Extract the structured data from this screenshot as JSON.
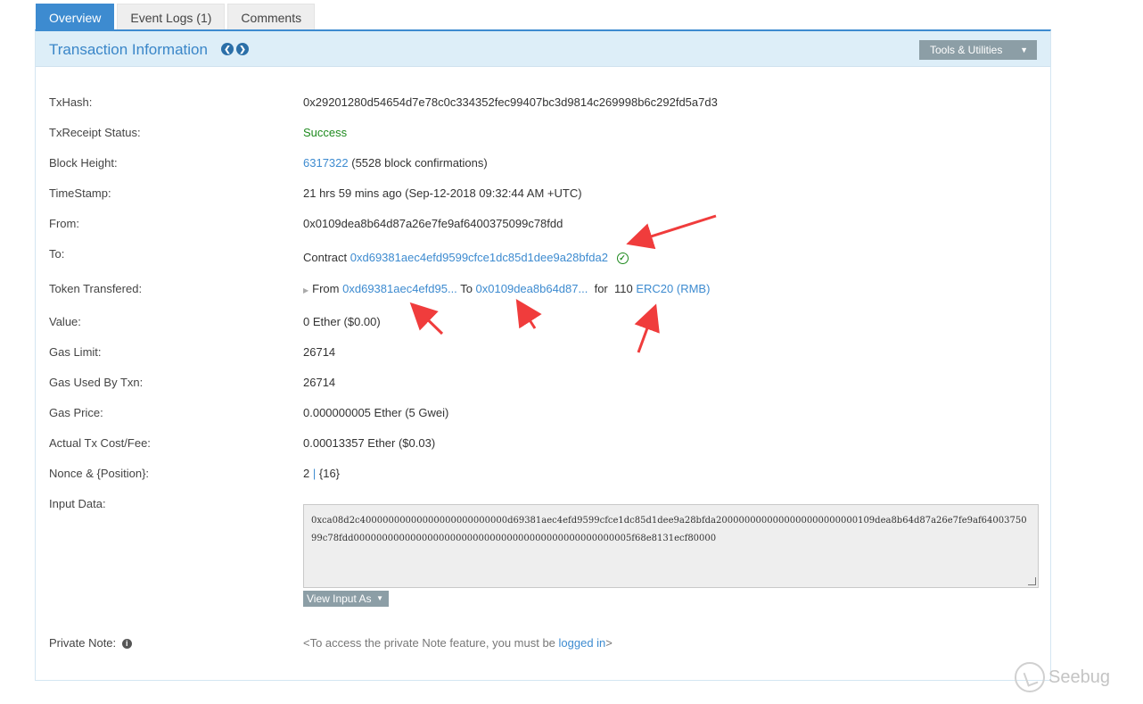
{
  "tabs": [
    {
      "label": "Overview",
      "active": true
    },
    {
      "label": "Event Logs (1)",
      "active": false
    },
    {
      "label": "Comments",
      "active": false
    }
  ],
  "header": {
    "title": "Transaction Information",
    "tools_label": "Tools & Utilities"
  },
  "rows": {
    "txhash": {
      "label": "TxHash:",
      "value": "0x29201280d54654d7e78c0c334352fec99407bc3d9814c269998b6c292fd5a7d3"
    },
    "status": {
      "label": "TxReceipt Status:",
      "value": "Success"
    },
    "block": {
      "label": "Block Height:",
      "block": "6317322",
      "confirmations": "(5528 block confirmations)"
    },
    "timestamp": {
      "label": "TimeStamp:",
      "value": "21 hrs 59 mins ago (Sep-12-2018 09:32:44 AM +UTC)"
    },
    "from": {
      "label": "From:",
      "value": "0x0109dea8b64d87a26e7fe9af6400375099c78fdd"
    },
    "to": {
      "label": "To:",
      "prefix": "Contract",
      "address": "0xd69381aec4efd9599cfce1dc85d1dee9a28bfda2"
    },
    "token": {
      "label": "Token Transfered:",
      "from_word": "From",
      "from_addr": "0xd69381aec4efd95...",
      "to_word": "To",
      "to_addr": "0x0109dea8b64d87...",
      "for_word": "for",
      "amount": "110",
      "token_name": "ERC20 (RMB)"
    },
    "value": {
      "label": "Value:",
      "value": "0 Ether ($0.00)"
    },
    "gas_limit": {
      "label": "Gas Limit:",
      "value": "26714"
    },
    "gas_used": {
      "label": "Gas Used By Txn:",
      "value": "26714"
    },
    "gas_price": {
      "label": "Gas Price:",
      "value": "0.000000005 Ether (5 Gwei)"
    },
    "tx_cost": {
      "label": "Actual Tx Cost/Fee:",
      "value": "0.00013357 Ether ($0.03)"
    },
    "nonce": {
      "label": "Nonce & {Position}:",
      "nonce": "2",
      "sep": "|",
      "position": "{16}"
    },
    "input": {
      "label": "Input Data:",
      "value": "0xca08d2c40000000000000000000000000d69381aec4efd9599cfce1dc85d1dee9a28bfda2000000000000000000000000109dea8b64d87a26e7fe9af6400375099c78fdd0000000000000000000000000000000000000000000000005f68e8131ecf80000",
      "view_label": "View Input As"
    },
    "private": {
      "label": "Private Note:",
      "prefix": "<To access the private Note feature, you must be ",
      "link": "logged in",
      "suffix": ">"
    }
  },
  "watermark": {
    "text": "Seebug"
  },
  "colors": {
    "accent": "#3d8bd0",
    "success": "#1e8a1e",
    "arrow": "#f03c3c"
  }
}
